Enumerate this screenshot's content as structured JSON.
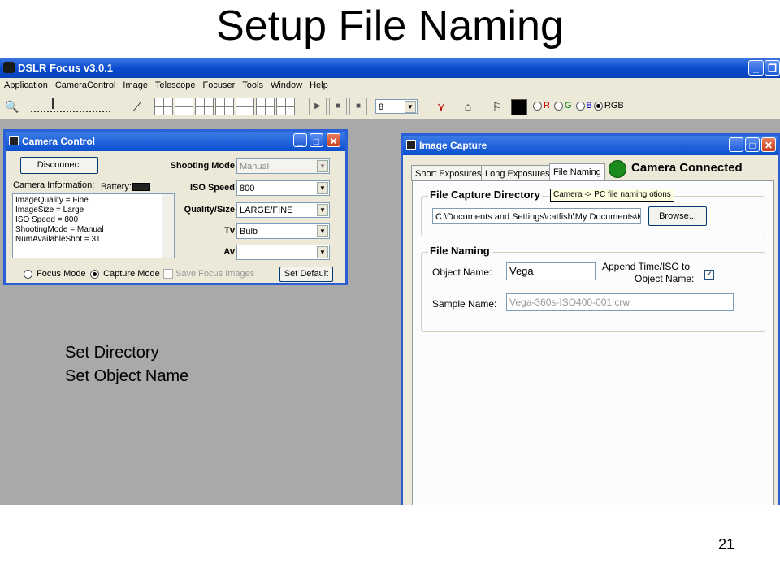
{
  "slide": {
    "title": "Setup File Naming",
    "page_number": "21",
    "annotations": [
      "Set Directory",
      "Set Object Name"
    ]
  },
  "app": {
    "title": "DSLR Focus v3.0.1",
    "menu": [
      "Application",
      "CameraControl",
      "Image",
      "Telescope",
      "Focuser",
      "Tools",
      "Window",
      "Help"
    ],
    "toolbar": {
      "exposure_select": "8",
      "channel_options": [
        "R",
        "G",
        "B",
        "RGB"
      ],
      "selected_channel": "RGB"
    }
  },
  "camera_control": {
    "title": "Camera Control",
    "disconnect_label": "Disconnect",
    "camera_info_label": "Camera Information:",
    "battery_label": "Battery:",
    "info_lines": [
      "ImageQuality = Fine",
      "ImageSize = Large",
      "ISO Speed = 800",
      "ShootingMode = Manual",
      "NumAvailableShot = 31"
    ],
    "fields": [
      {
        "label": "Shooting Mode",
        "value": "Manual",
        "disabled": true
      },
      {
        "label": "ISO Speed",
        "value": "800"
      },
      {
        "label": "Quality/Size",
        "value": "LARGE/FINE"
      },
      {
        "label": "Tv",
        "value": "Bulb"
      },
      {
        "label": "Av",
        "value": ""
      }
    ],
    "focus_mode_label": "Focus Mode",
    "capture_mode_label": "Capture Mode",
    "save_focus_label": "Save Focus Images",
    "set_default_label": "Set Default"
  },
  "image_capture": {
    "title": "Image Capture",
    "tabs": [
      "Short Exposures",
      "Long Exposures",
      "File Naming"
    ],
    "active_tab": "File Naming",
    "status": "Camera Connected",
    "status_color": "#1a8a1a",
    "directory_group": "File Capture Directory",
    "tooltip": "Camera -> PC file naming otions",
    "directory_value": "C:\\Documents and Settings\\catfish\\My Documents\\My",
    "browse_label": "Browse...",
    "naming_group": "File Naming",
    "object_name_label": "Object Name:",
    "object_name_value": "Vega",
    "append_label_1": "Append Time/ISO to",
    "append_label_2": "Object Name:",
    "append_checked": true,
    "sample_name_label": "Sample Name:",
    "sample_name_value": "Vega-360s-ISO400-001.crw"
  }
}
